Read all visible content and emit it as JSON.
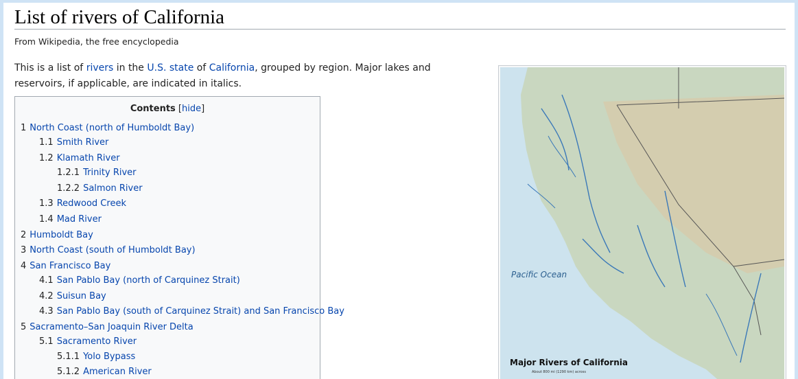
{
  "page": {
    "title": "List of rivers of California",
    "tagline": "From Wikipedia, the free encyclopedia"
  },
  "intro": {
    "t1": "This is a list of ",
    "link_rivers": "rivers",
    "t2": " in the ",
    "link_us_state": "U.S. state",
    "t3": " of ",
    "link_california": "California",
    "t4": ", grouped by region. Major lakes and reservoirs, if applicable, are indicated in italics."
  },
  "toc": {
    "title": "Contents",
    "hide_open": "[",
    "hide_label": "hide",
    "hide_close": "]",
    "items": [
      {
        "num": "1",
        "label": "North Coast (north of Humboldt Bay)"
      },
      {
        "num": "1.1",
        "label": "Smith River"
      },
      {
        "num": "1.2",
        "label": "Klamath River"
      },
      {
        "num": "1.2.1",
        "label": "Trinity River"
      },
      {
        "num": "1.2.2",
        "label": "Salmon River"
      },
      {
        "num": "1.3",
        "label": "Redwood Creek"
      },
      {
        "num": "1.4",
        "label": "Mad River"
      },
      {
        "num": "2",
        "label": "Humboldt Bay"
      },
      {
        "num": "3",
        "label": "North Coast (south of Humboldt Bay)"
      },
      {
        "num": "4",
        "label": "San Francisco Bay"
      },
      {
        "num": "4.1",
        "label": "San Pablo Bay (north of Carquinez Strait)"
      },
      {
        "num": "4.2",
        "label": "Suisun Bay"
      },
      {
        "num": "4.3",
        "label": "San Pablo Bay (south of Carquinez Strait) and San Francisco Bay"
      },
      {
        "num": "5",
        "label": "Sacramento–San Joaquin River Delta"
      },
      {
        "num": "5.1",
        "label": "Sacramento River"
      },
      {
        "num": "5.1.1",
        "label": "Yolo Bypass"
      },
      {
        "num": "5.1.2",
        "label": "American River"
      }
    ]
  },
  "map": {
    "caption": "Major Rivers of California",
    "scale_text": "About 800 mi (1290 km) across",
    "ocean_label": "Pacific Ocean",
    "colors": {
      "ocean": "#cde3ee",
      "land": "#c9d7c0",
      "relief": "#d9c9a8",
      "river": "#3a78b8",
      "border": "#555555"
    }
  }
}
